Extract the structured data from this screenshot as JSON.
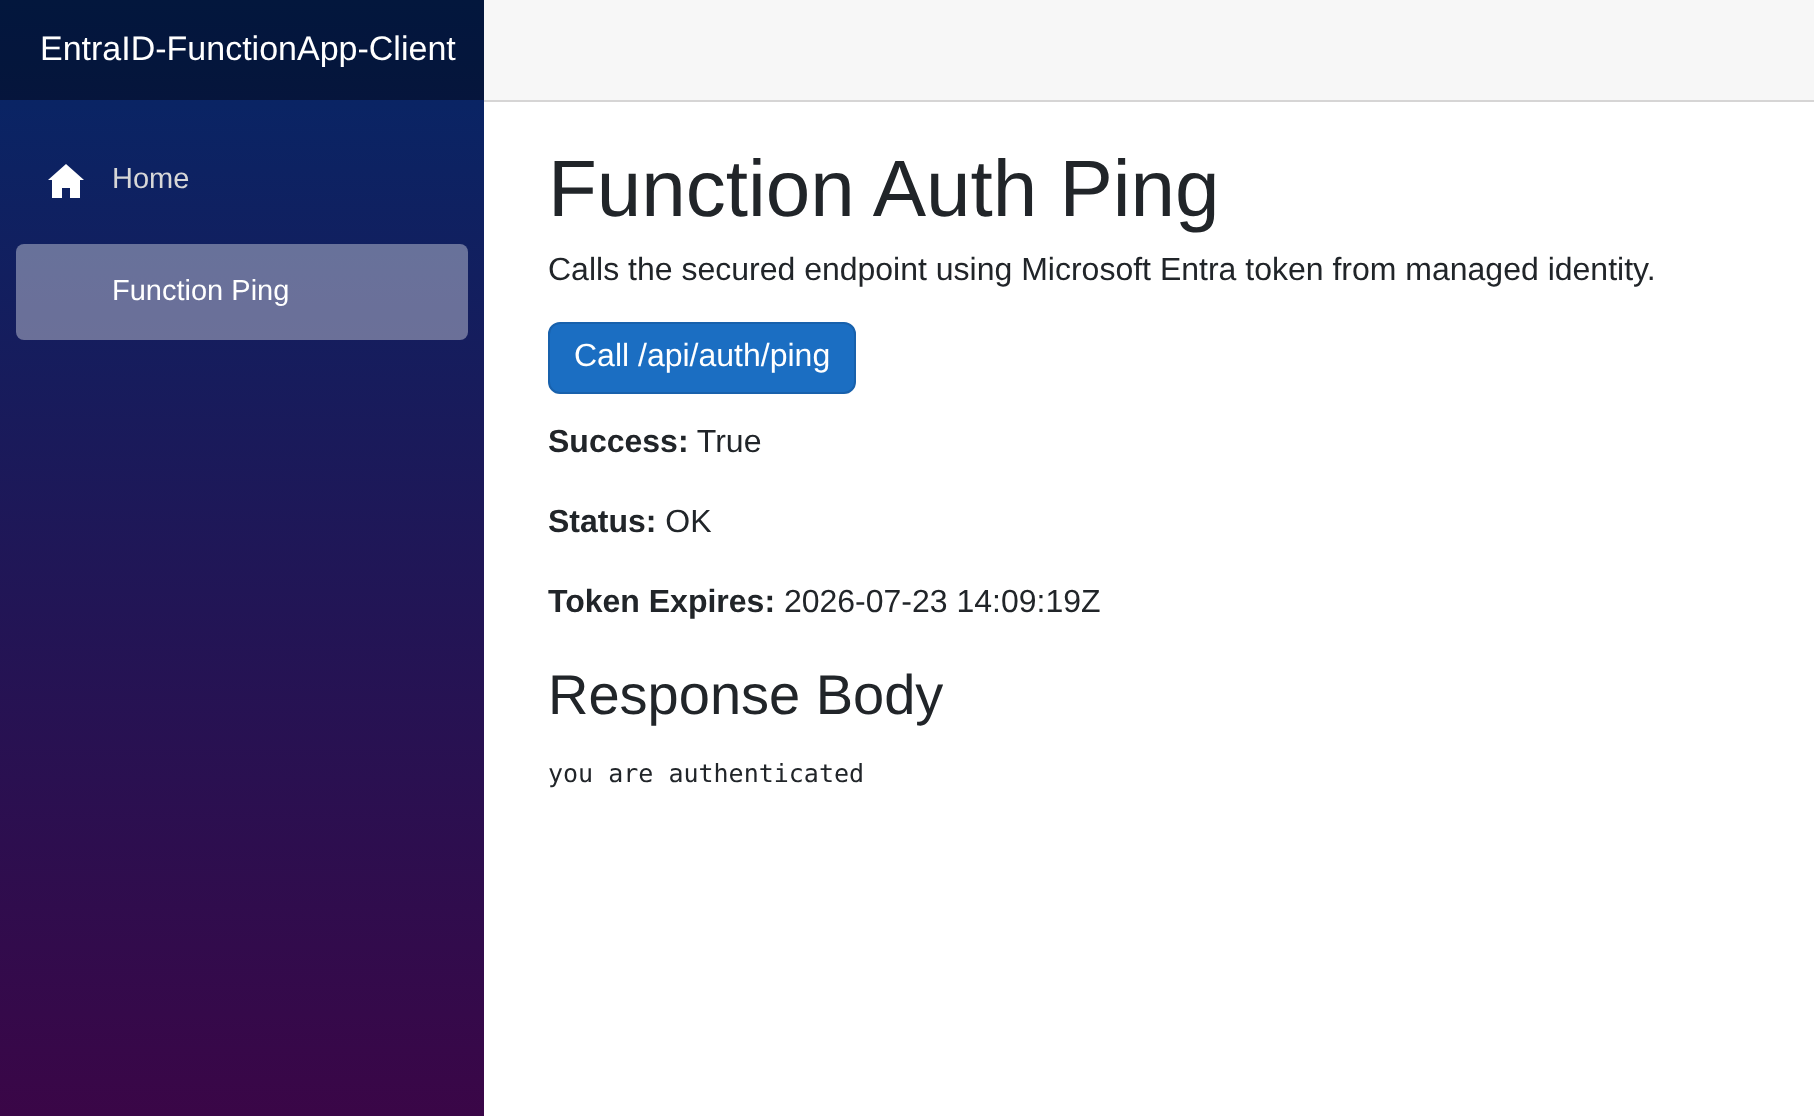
{
  "app_title": "EntraID-FunctionApp-Client",
  "nav": [
    {
      "label": "Home",
      "has_icon": true,
      "selected": false
    },
    {
      "label": "Function Ping",
      "has_icon": false,
      "selected": true
    }
  ],
  "page": {
    "title": "Function Auth Ping",
    "description": "Calls the secured endpoint using Microsoft Entra token from managed identity.",
    "button": "Call /api/auth/ping",
    "fields": [
      "**Success:** True",
      "**Status:** OK",
      "**Token Expires:** 2026-07-23 14:09:19Z"
    ],
    "response_heading": "Response Body",
    "response_body": "you are authenticated"
  }
}
